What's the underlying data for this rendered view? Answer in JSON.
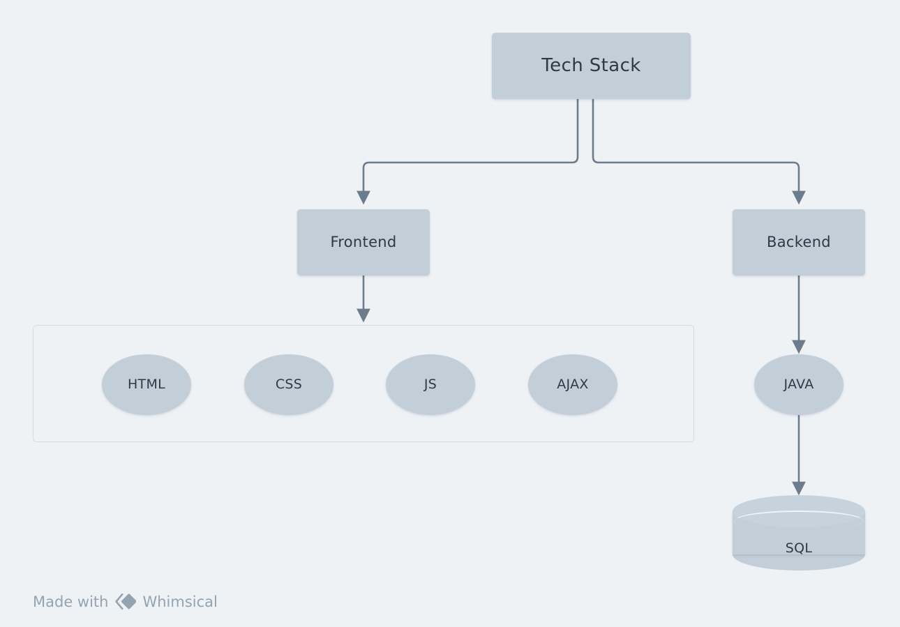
{
  "diagram": {
    "title": "Tech Stack",
    "background_color": "#eff2f5",
    "node_fill": "#c2cfd9",
    "node_text_color": "#2d3a45",
    "edge_color": "#6b7d8d",
    "group_border_color": "#d2dce4"
  },
  "nodes": {
    "root": {
      "label": "Tech Stack"
    },
    "frontend": {
      "label": "Frontend"
    },
    "backend": {
      "label": "Backend"
    },
    "html": {
      "label": "HTML"
    },
    "css": {
      "label": "CSS"
    },
    "js": {
      "label": "JS"
    },
    "ajax": {
      "label": "AJAX"
    },
    "java": {
      "label": "JAVA"
    },
    "sql": {
      "label": "SQL"
    }
  },
  "footer": {
    "made_with": "Made with",
    "brand": "Whimsical",
    "logo_icon": "whimsical-diamond-logo"
  }
}
